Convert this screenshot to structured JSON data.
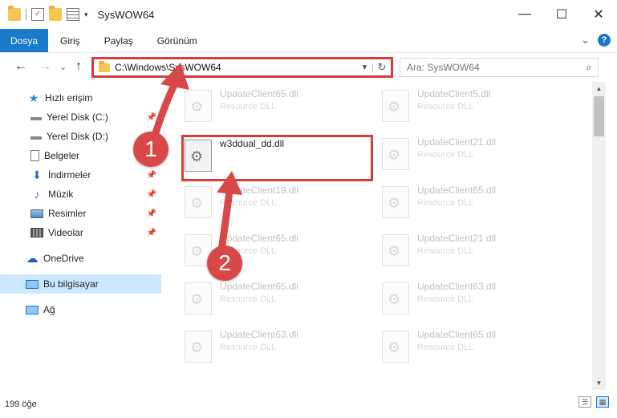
{
  "window": {
    "title": "SysWOW64",
    "minimize": "—",
    "maximize": "☐",
    "close": "✕"
  },
  "ribbon": {
    "tabs": [
      {
        "label": "Dosya",
        "active": true
      },
      {
        "label": "Giriş"
      },
      {
        "label": "Paylaş"
      },
      {
        "label": "Görünüm"
      }
    ],
    "expand_glyph": "⌄",
    "help_glyph": "?"
  },
  "nav": {
    "back": "←",
    "forward": "→",
    "recent": "⌄",
    "up": "↑",
    "address": "C:\\Windows\\SysWOW64",
    "search_placeholder": "Ara: SysWOW64"
  },
  "sidebar": {
    "items": [
      {
        "label": "Hızlı erişim"
      },
      {
        "label": "Yerel Disk (C:)"
      },
      {
        "label": "Yerel Disk (D:)"
      },
      {
        "label": "Belgeler"
      },
      {
        "label": "İndirmeler"
      },
      {
        "label": "Müzik"
      },
      {
        "label": "Resimler"
      },
      {
        "label": "Videolar"
      },
      {
        "label": "OneDrive"
      },
      {
        "label": "Bu bilgisayar"
      },
      {
        "label": "Ağ"
      }
    ]
  },
  "files": [
    {
      "name": "UpdateClient65.dll",
      "type": "Resource DLL"
    },
    {
      "name": "UpdateClient5.dll",
      "type": "Resource DLL"
    },
    {
      "name": "w3ddual_dd.dll",
      "type": ""
    },
    {
      "name": "UpdateClient21.dll",
      "type": "Resource DLL"
    },
    {
      "name": "UpdateClient19.dll",
      "type": "Resource DLL"
    },
    {
      "name": "UpdateClient65.dll",
      "type": "Resource DLL"
    },
    {
      "name": "UpdateClient65.dll",
      "type": "Resource DLL"
    },
    {
      "name": "UpdateClient21.dll",
      "type": "Resource DLL"
    },
    {
      "name": "UpdateClient65.dll",
      "type": "Resource DLL"
    },
    {
      "name": "UpdateClient63.dll",
      "type": "Resource DLL"
    },
    {
      "name": "UpdateClient63.dll",
      "type": "Resource DLL"
    },
    {
      "name": "UpdateClient65.dll",
      "type": "Resource DLL"
    }
  ],
  "status": {
    "count": "199 öğe"
  },
  "annotations": {
    "step1": "1",
    "step2": "2"
  },
  "colors": {
    "accent": "#1979ca",
    "highlight": "#d93a3a",
    "badge": "#d94848",
    "selected": "#cce8ff"
  }
}
